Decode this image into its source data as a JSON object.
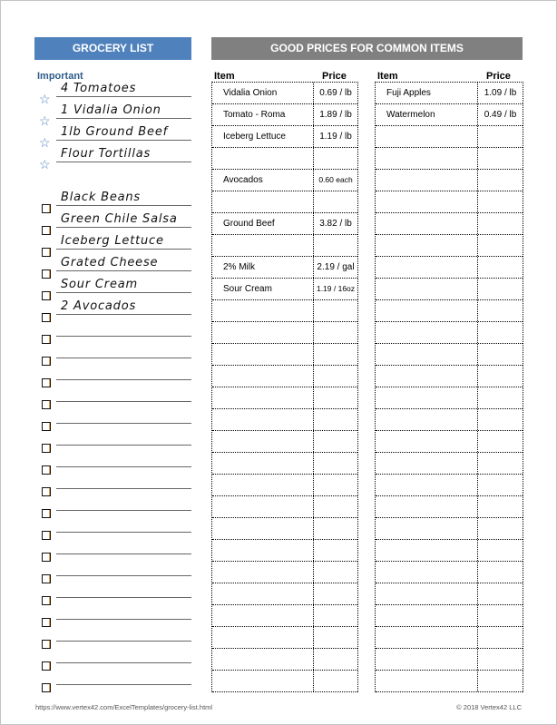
{
  "grocery_list": {
    "title": "GROCERY LIST",
    "important_label": "Important",
    "important_items": [
      "4 Tomatoes",
      "1 Vidalia Onion",
      "1lb Ground Beef",
      "Flour Tortillas"
    ],
    "checklist_items": [
      "Black Beans",
      "Green Chile Salsa",
      "Iceberg Lettuce",
      "Grated Cheese",
      "Sour Cream",
      "2 Avocados",
      "",
      "",
      "",
      "",
      "",
      "",
      "",
      "",
      "",
      "",
      "",
      "",
      "",
      "",
      "",
      "",
      ""
    ]
  },
  "prices": {
    "title": "GOOD PRICES FOR COMMON ITEMS",
    "col_item": "Item",
    "col_price": "Price",
    "left_table": [
      {
        "item": "Vidalia Onion",
        "price": "0.69 / lb"
      },
      {
        "item": "Tomato - Roma",
        "price": "1.89 / lb"
      },
      {
        "item": "Iceberg Lettuce",
        "price": "1.19 / lb"
      },
      {
        "item": "",
        "price": ""
      },
      {
        "item": "Avocados",
        "price": "0.60 each",
        "small": true
      },
      {
        "item": "",
        "price": ""
      },
      {
        "item": "Ground Beef",
        "price": "3.82 / lb"
      },
      {
        "item": "",
        "price": ""
      },
      {
        "item": "2% Milk",
        "price": "2.19 / gal"
      },
      {
        "item": "Sour Cream",
        "price": "1.19 / 16oz",
        "small": true
      }
    ],
    "right_table": [
      {
        "item": "Fuji Apples",
        "price": "1.09 / lb"
      },
      {
        "item": "Watermelon",
        "price": "0.49 / lb"
      }
    ],
    "total_rows": 28
  },
  "footer": {
    "url": "https://www.vertex42.com/ExcelTemplates/grocery-list.html",
    "copyright": "© 2018 Vertex42 LLC"
  },
  "icons": {
    "star": "☆"
  }
}
